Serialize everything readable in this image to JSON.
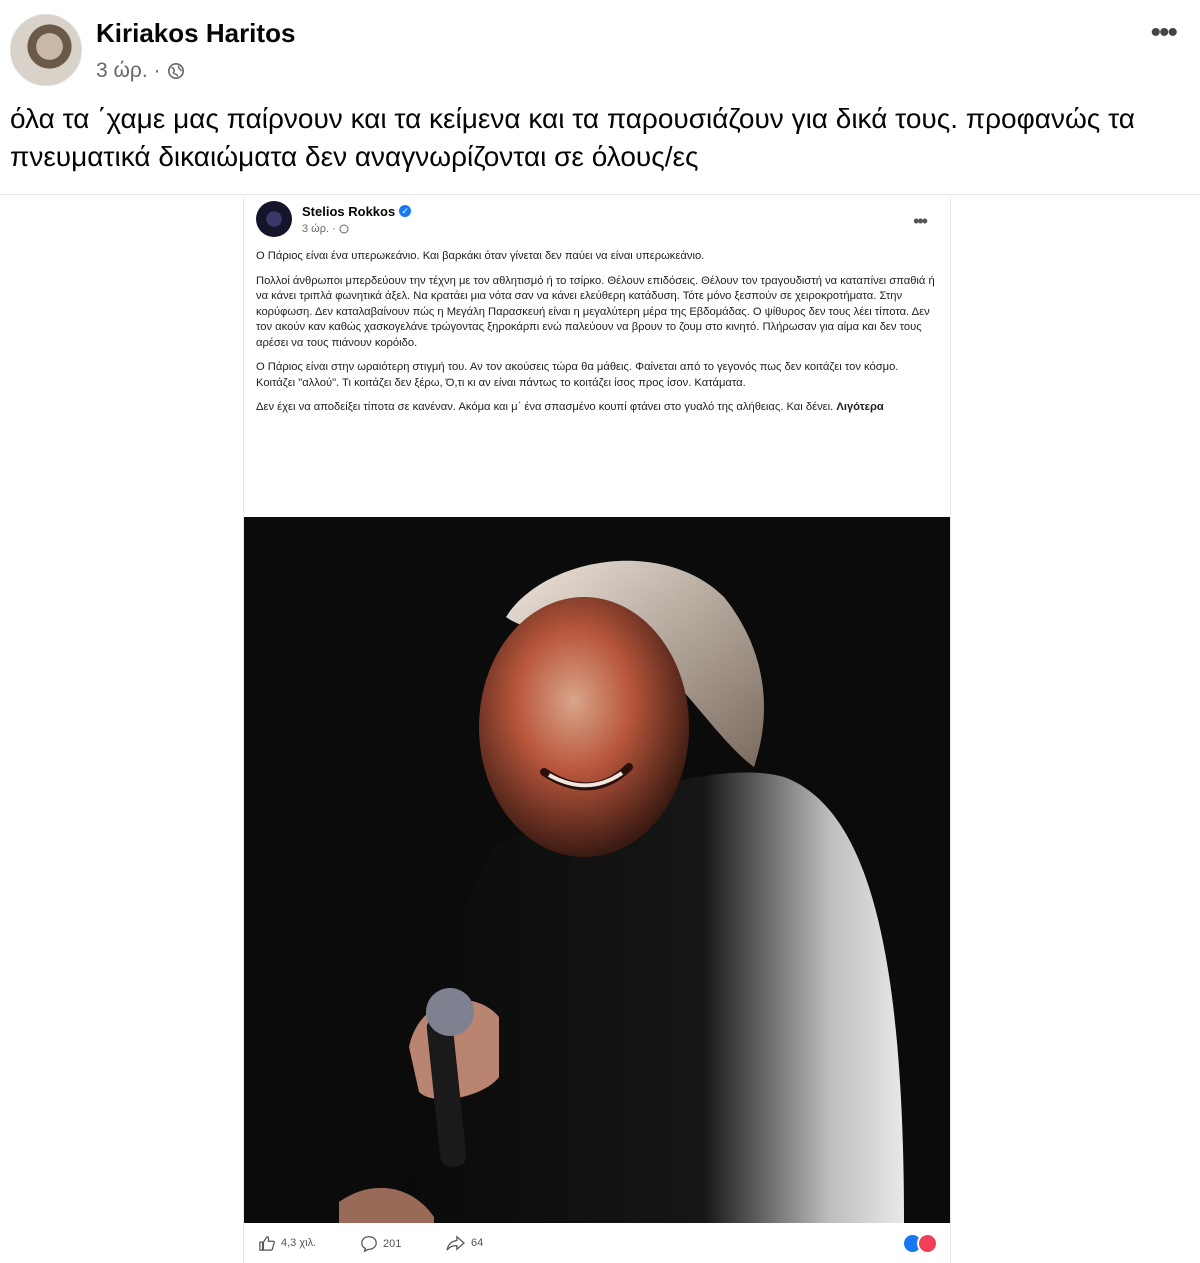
{
  "outer_post": {
    "author": "Kiriakos Haritos",
    "time": "3 ώρ. ·",
    "text": "όλα τα ΄χαμε μας παίρνουν και τα κείμενα και τα παρουσιάζουν για δικά τους. προφανώς τα πνευματικά δικαιώματα δεν αναγνωρίζονται σε όλους/ες"
  },
  "shared_post": {
    "author": "Stelios Rokkos",
    "time": "3 ώρ. ·",
    "paragraphs": [
      "Ο Πάριος είναι ένα υπερωκεάνιο. Και βαρκάκι όταν γίνεται δεν παύει να είναι υπερωκεάνιο.",
      "Πολλοί άνθρωποι μπερδεύουν την τέχνη με τον αθλητισμό ή το τσίρκο. Θέλουν επιδόσεις. Θέλουν τον τραγουδιστή να καταπίνει σπαθιά ή να κάνει τριπλά φωνητικά άξελ. Να κρατάει μια νότα σαν να κάνει ελεύθερη κατάδυση. Τότε μόνο ξεσπούν σε χειροκροτήματα. Στην κορύφωση. Δεν καταλαβαίνουν πώς η Μεγάλη Παρασκευή είναι η μεγαλύτερη μέρα της Εβδομάδας. Ο ψίθυρος δεν τους λέει τίποτα. Δεν τον ακούν καν καθώς χασκογελάνε τρώγοντας ξηροκάρπι ενώ παλεύουν να βρουν το ζουμ στο κινητό. Πλήρωσαν για αίμα και δεν τους αρέσει να τους πιάνουν κορόιδο.",
      "Ο Πάριος είναι στην ωραιότερη στιγμή του. Αν τον ακούσεις τώρα θα μάθεις. Φαίνεται από το γεγονός πως δεν κοιτάζει τον κόσμο. Κοιτάζει \"αλλού\". Τι κοιτάζει δεν ξέρω, Ό,τι κι αν είναι πάντως το κοιτάζει ίσος προς ίσον. Κατάματα.",
      "Δεν έχει να αποδείξει τίποτα σε κανέναν. Ακόμα και μ΄ ένα σπασμένο κουπί φτάνει στο γυαλό της αλήθειας. Και δένει."
    ],
    "more_label": "Λιγότερα",
    "likes": "4,3 χιλ.",
    "comments": "201",
    "shares": "64"
  },
  "colors": {
    "accent": "#1877f2",
    "love": "#f33e58"
  },
  "icons": [
    "globe-icon",
    "more-icon",
    "verified-icon",
    "like-icon",
    "comment-icon",
    "share-icon"
  ]
}
